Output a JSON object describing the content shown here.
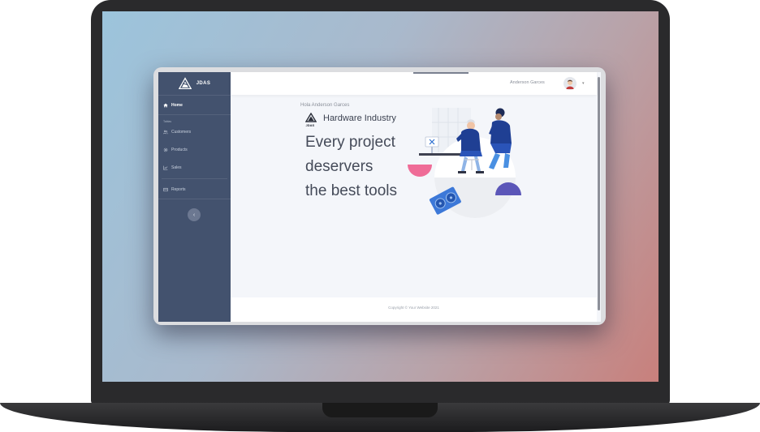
{
  "app": {
    "brand": "JDAS",
    "user_name": "Anderson Garces",
    "greeting": "Hola Anderson Garces",
    "hero_brand": "Hardware Industry",
    "headline": [
      "Every project",
      "deservers",
      "the best tools"
    ],
    "copyright": "Copyright © Your Website 2021"
  },
  "sidebar": {
    "home_label": "Home",
    "section_label": "Tablas",
    "items": [
      {
        "label": "Customers",
        "icon": "users-icon"
      },
      {
        "label": "Products",
        "icon": "gear-icon"
      },
      {
        "label": "Sales",
        "icon": "chart-icon"
      },
      {
        "label": "Reports",
        "icon": "report-icon"
      }
    ],
    "collapse_symbol": "‹"
  },
  "header": {
    "caret": "▾"
  },
  "colors": {
    "sidebar_bg": "#43526e",
    "content_bg": "#f4f6fa",
    "accent_blue": "#1f3f93",
    "accent_pink": "#ef6c97"
  }
}
